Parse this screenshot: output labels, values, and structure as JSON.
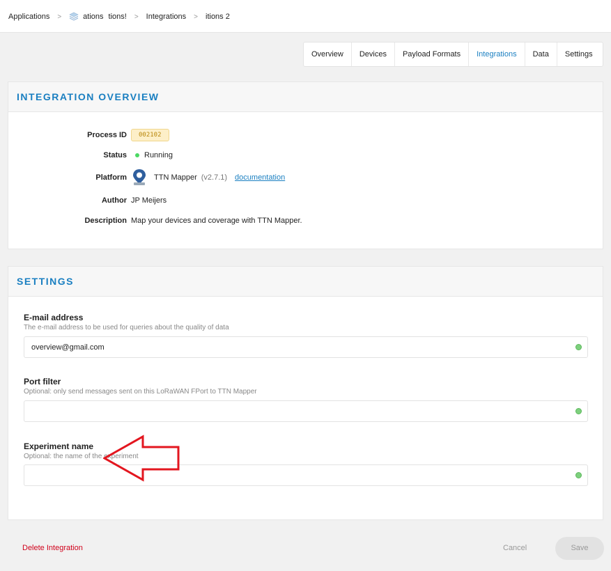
{
  "breadcrumb": {
    "items": [
      "Applications",
      "ations",
      "tions!",
      "Integrations",
      "itions 2"
    ]
  },
  "tabs": [
    {
      "label": "Overview",
      "active": false
    },
    {
      "label": "Devices",
      "active": false
    },
    {
      "label": "Payload Formats",
      "active": false
    },
    {
      "label": "Integrations",
      "active": true
    },
    {
      "label": "Data",
      "active": false
    },
    {
      "label": "Settings",
      "active": false
    }
  ],
  "overview": {
    "title": "INTEGRATION OVERVIEW",
    "process_id_label": "Process ID",
    "process_id": "002102",
    "status_label": "Status",
    "status": "Running",
    "platform_label": "Platform",
    "platform_name": "TTN Mapper",
    "platform_version": "(v2.7.1)",
    "documentation": "documentation",
    "author_label": "Author",
    "author": "JP Meijers",
    "description_label": "Description",
    "description": "Map your devices and coverage with TTN Mapper."
  },
  "settings": {
    "title": "SETTINGS",
    "email_label": "E-mail address",
    "email_help": "The e-mail address to be used for queries about the quality of data",
    "email_value": "overview@gmail.com",
    "port_label": "Port filter",
    "port_help": "Optional: only send messages sent on this LoRaWAN FPort to TTN Mapper",
    "port_value": "",
    "experiment_label": "Experiment name",
    "experiment_help": "Optional: the name of the experiment",
    "experiment_value": ""
  },
  "footer": {
    "delete": "Delete Integration",
    "cancel": "Cancel",
    "save": "Save"
  },
  "colors": {
    "accent": "#1a7fc1",
    "danger": "#d0021b",
    "annotation_arrow": "#e3161f",
    "status_ok": "#4cd964"
  }
}
